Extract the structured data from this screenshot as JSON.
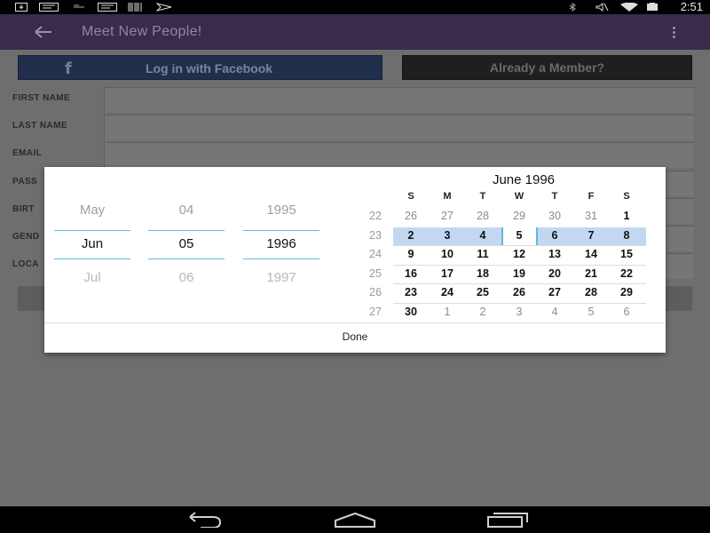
{
  "status_bar": {
    "time": "2:51",
    "left_icons": [
      "download-icon",
      "message-icon",
      "voicemail-icon",
      "message-icon",
      "barcode-icon",
      "flight-icon"
    ],
    "right_icons": [
      "bluetooth-icon",
      "no-sound-icon",
      "wifi-icon",
      "battery-icon"
    ]
  },
  "app_bar": {
    "title": "Meet New People!"
  },
  "signup": {
    "facebook_label": "Log in with Facebook",
    "member_label": "Already a Member?",
    "fields": [
      {
        "label": "FIRST NAME",
        "value": ""
      },
      {
        "label": "LAST NAME",
        "value": ""
      },
      {
        "label": "EMAIL",
        "value": ""
      },
      {
        "label": "PASS",
        "value": ""
      },
      {
        "label": "BIRT",
        "value": ""
      },
      {
        "label": "GEND",
        "value": ""
      },
      {
        "label": "LOCA",
        "value": ""
      }
    ]
  },
  "date_picker": {
    "month_spinner": {
      "prev": "May",
      "current": "Jun",
      "next": "Jul"
    },
    "day_spinner": {
      "prev": "04",
      "current": "05",
      "next": "06"
    },
    "year_spinner": {
      "prev": "1995",
      "current": "1996",
      "next": "1997"
    },
    "calendar": {
      "title": "June 1996",
      "days_of_week": [
        "S",
        "M",
        "T",
        "W",
        "T",
        "F",
        "S"
      ],
      "weeks": [
        {
          "num": "22",
          "days": [
            "26",
            "27",
            "28",
            "29",
            "30",
            "31",
            "1"
          ]
        },
        {
          "num": "23",
          "days": [
            "2",
            "3",
            "4",
            "5",
            "6",
            "7",
            "8"
          ]
        },
        {
          "num": "24",
          "days": [
            "9",
            "10",
            "11",
            "12",
            "13",
            "14",
            "15"
          ]
        },
        {
          "num": "25",
          "days": [
            "16",
            "17",
            "18",
            "19",
            "20",
            "21",
            "22"
          ]
        },
        {
          "num": "26",
          "days": [
            "23",
            "24",
            "25",
            "26",
            "27",
            "28",
            "29"
          ]
        },
        {
          "num": "27",
          "days": [
            "30",
            "1",
            "2",
            "3",
            "4",
            "5",
            "6"
          ]
        }
      ],
      "selected_day": "5"
    },
    "done_label": "Done"
  },
  "nav_bar": {
    "buttons": [
      "back-icon",
      "home-icon",
      "recent-apps-icon"
    ]
  },
  "colors": {
    "app_bar": "#3a2b4c",
    "accent": "#5bbbdc",
    "selected_week": "#c3d7f2",
    "facebook_button": "#212f4d"
  }
}
